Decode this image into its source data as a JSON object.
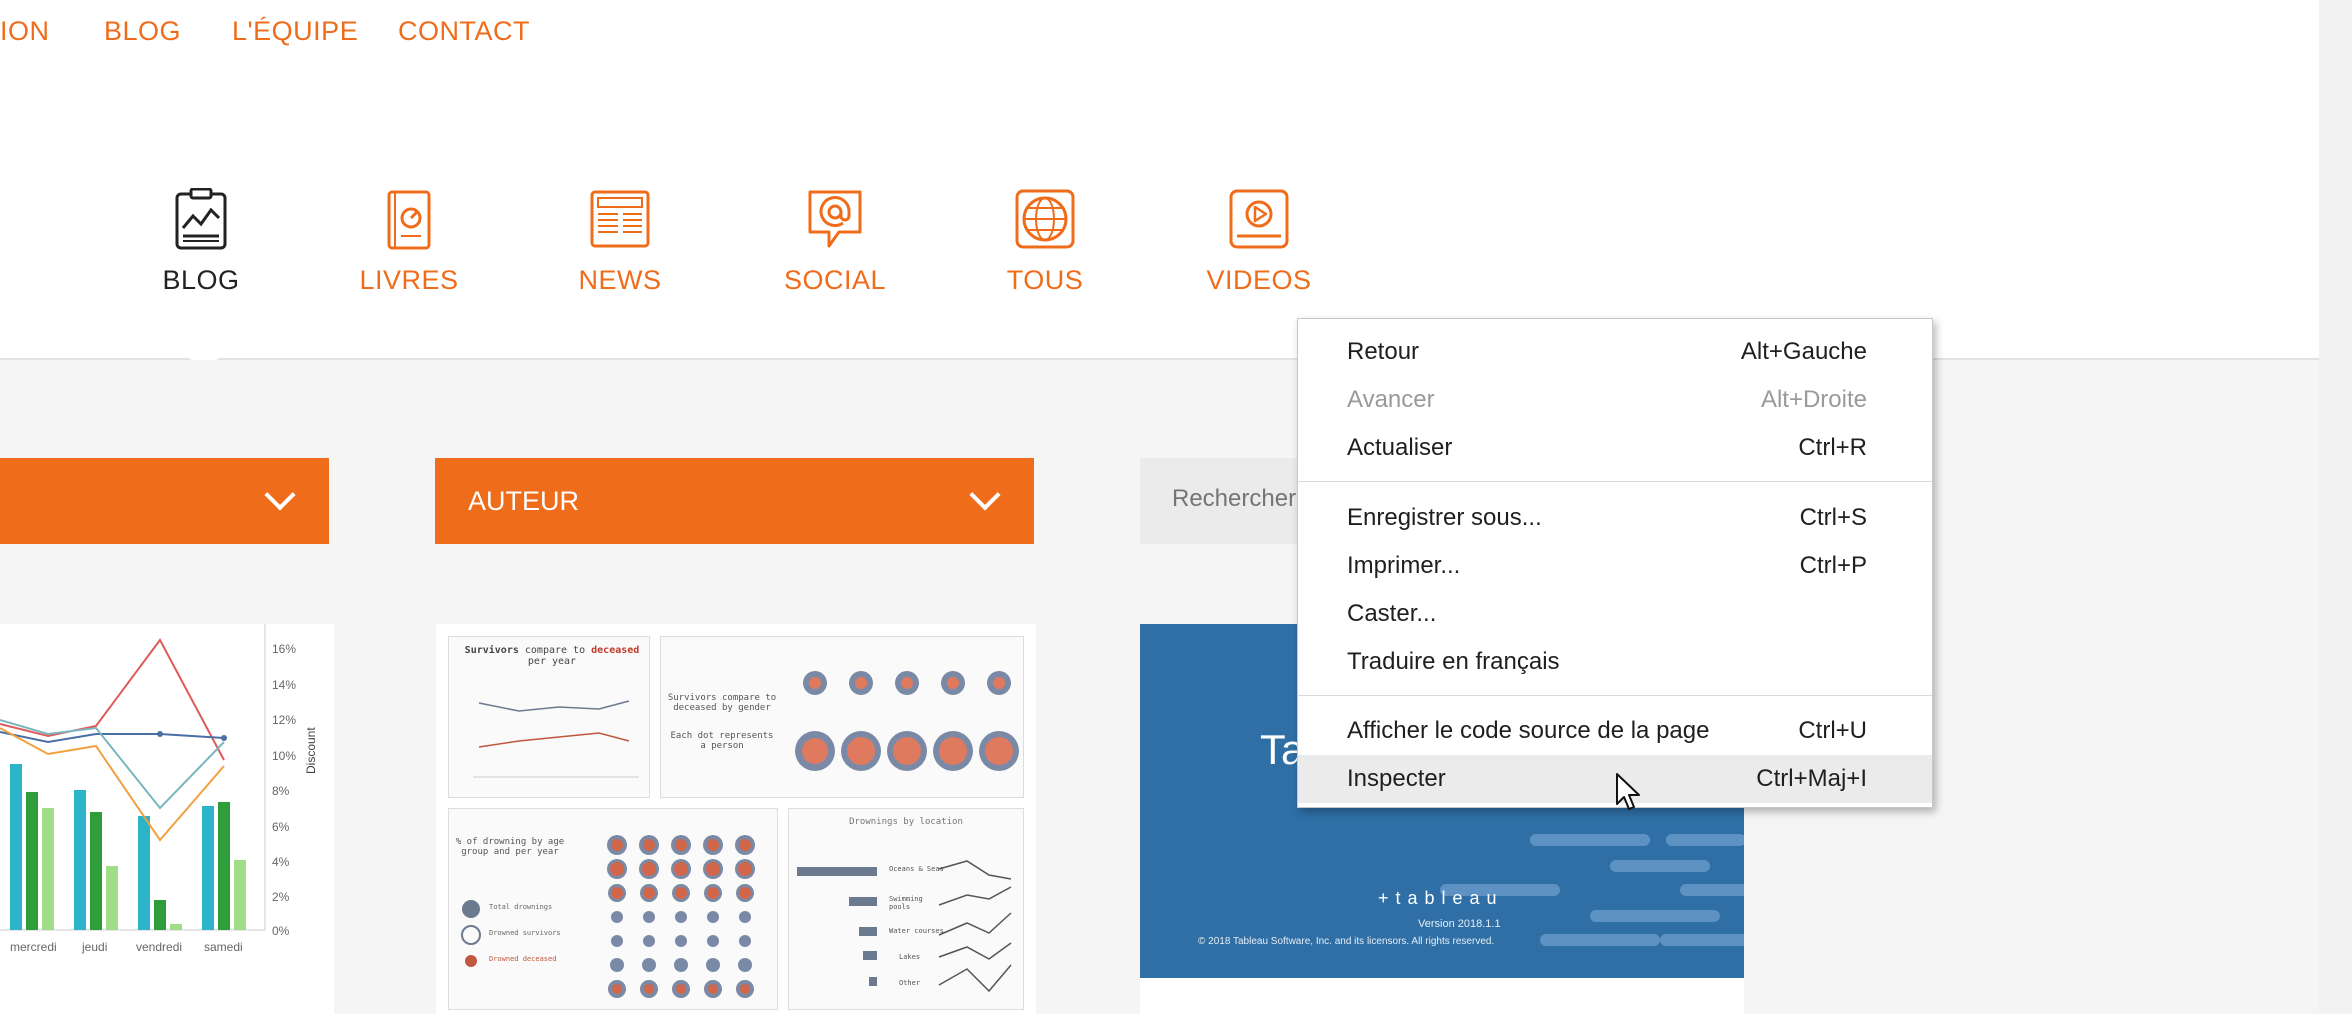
{
  "top_nav": {
    "items": [
      "ION",
      "BLOG",
      "L'ÉQUIPE",
      "CONTACT"
    ]
  },
  "categories": [
    {
      "label": "BLOG",
      "icon": "clipboard-chart-icon"
    },
    {
      "label": "LIVRES",
      "icon": "book-icon"
    },
    {
      "label": "NEWS",
      "icon": "newspaper-icon"
    },
    {
      "label": "SOCIAL",
      "icon": "chat-at-icon"
    },
    {
      "label": "TOUS",
      "icon": "globe-icon"
    },
    {
      "label": "VIDEOS",
      "icon": "video-play-icon"
    }
  ],
  "filters": {
    "first_label": "",
    "author_label": "AUTEUR",
    "search_placeholder": "Rechercher ..."
  },
  "chart_card": {
    "day_labels": [
      "mercredi",
      "jeudi",
      "vendredi",
      "samedi"
    ],
    "pct_ticks": [
      "16%",
      "14%",
      "12%",
      "10%",
      "8%",
      "6%",
      "4%",
      "2%",
      "0%"
    ],
    "axis_title": "Discount"
  },
  "titanic_card": {
    "panel1_title_a": "Survivors",
    "panel1_title_b": "compare to",
    "panel1_title_c": "deceased",
    "panel1_title_d": "per year",
    "panel2_text": "Survivors compare to deceased by gender",
    "panel2_note": "Each dot represents a person",
    "panel3_title": "% of drowning by age group and per year",
    "panel3_legend": [
      "Total drownings",
      "Drowned survivors",
      "Drowned deceased"
    ],
    "panel4_title": "Drownings by location",
    "panel4_rows": [
      "Oceans & Seas",
      "Swimming pools",
      "Water courses",
      "Lakes",
      "Other"
    ]
  },
  "tableau_card": {
    "title_fragment": "Ta",
    "logo_text": "+ t a b l e a u",
    "version": "Version 2018.1.1",
    "copyright": "© 2018 Tableau Software, Inc. and its licensors. All rights reserved."
  },
  "context_menu": {
    "items": [
      {
        "label": "Retour",
        "shortcut": "Alt+Gauche",
        "disabled": false
      },
      {
        "label": "Avancer",
        "shortcut": "Alt+Droite",
        "disabled": true
      },
      {
        "label": "Actualiser",
        "shortcut": "Ctrl+R",
        "disabled": false
      },
      {
        "label": "Enregistrer sous...",
        "shortcut": "Ctrl+S",
        "disabled": false
      },
      {
        "label": "Imprimer...",
        "shortcut": "Ctrl+P",
        "disabled": false
      },
      {
        "label": "Caster...",
        "shortcut": "",
        "disabled": false
      },
      {
        "label": "Traduire en français",
        "shortcut": "",
        "disabled": false
      },
      {
        "label": "Afficher le code source de la page",
        "shortcut": "Ctrl+U",
        "disabled": false
      },
      {
        "label": "Inspecter",
        "shortcut": "Ctrl+Maj+I",
        "disabled": false,
        "highlighted": true
      }
    ]
  },
  "colors": {
    "accent": "#ef6c1a",
    "tableau_blue": "#2f6fa5",
    "menu_highlight": "#ebebeb"
  }
}
